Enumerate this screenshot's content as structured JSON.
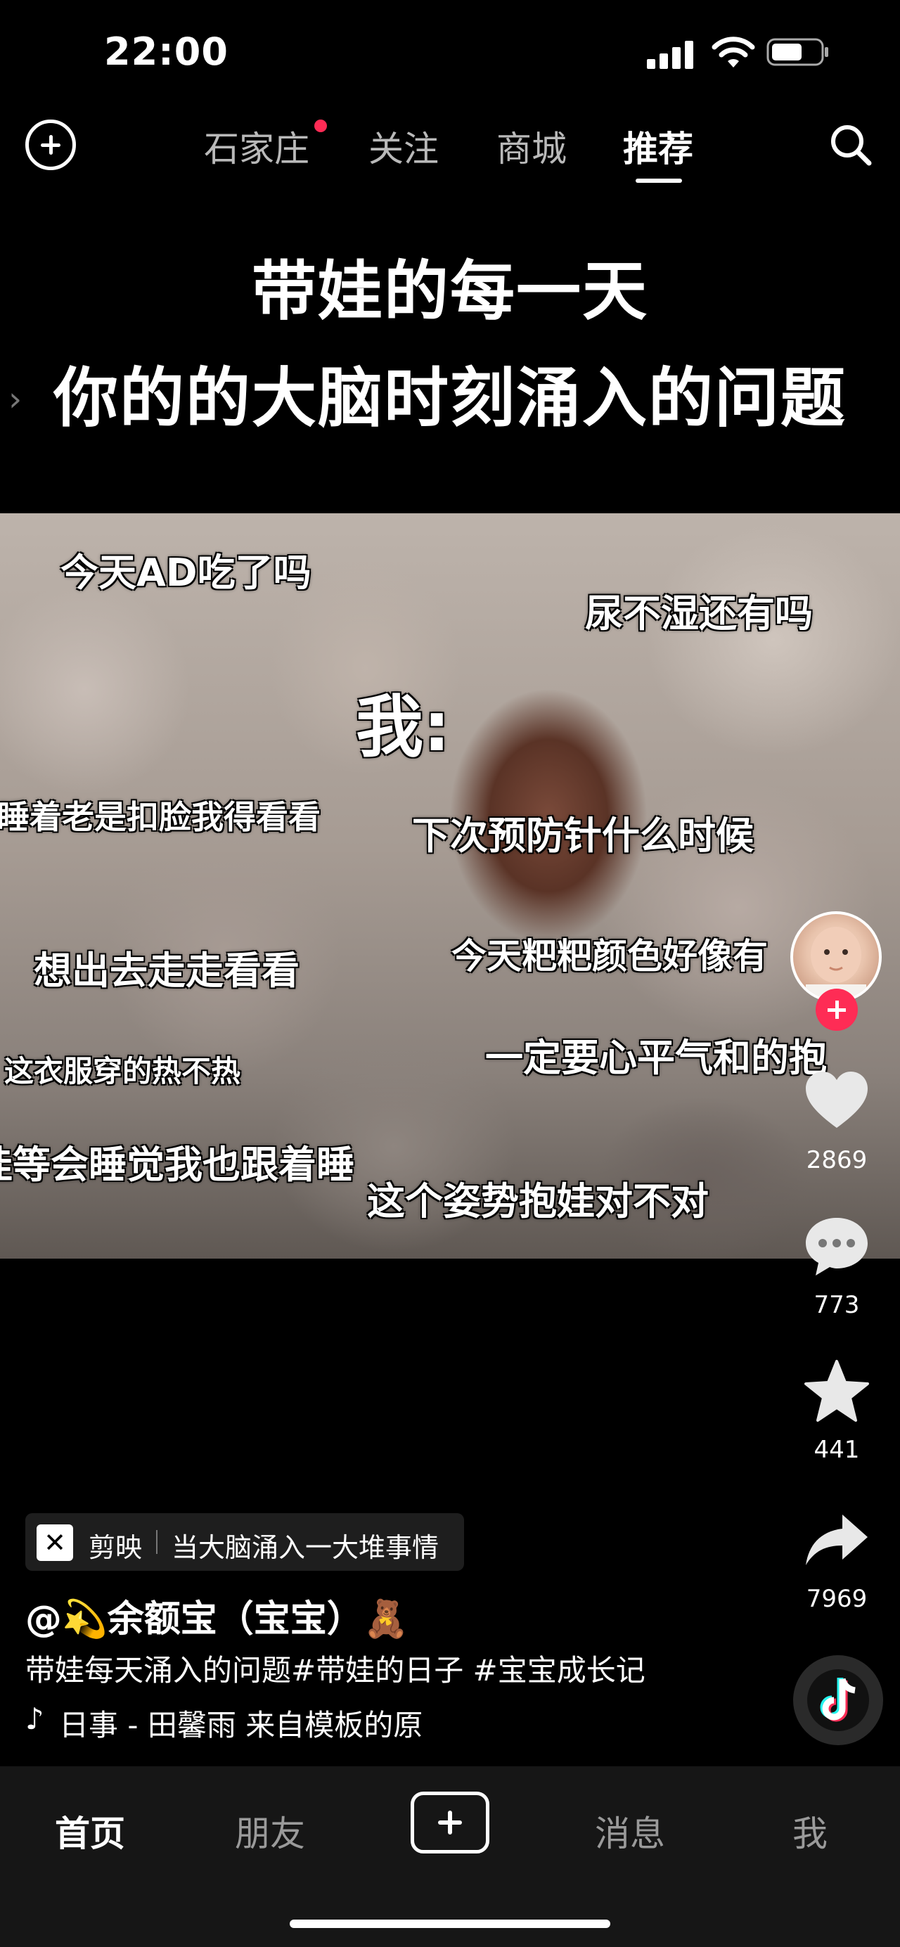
{
  "status_bar": {
    "time": "22:00"
  },
  "top_nav": {
    "tabs": [
      {
        "label": "石家庄",
        "has_dot": true
      },
      {
        "label": "关注"
      },
      {
        "label": "商城"
      },
      {
        "label": "推荐",
        "active": true
      }
    ]
  },
  "video": {
    "headline_line1": "带娃的每一天",
    "headline_line2": "你的的大脑时刻涌入的问题",
    "overlay_texts": [
      "今天AD吃了吗",
      "尿不湿还有吗",
      "我:",
      "睡着老是扣脸我得看看",
      "下次预防针什么时候",
      "今天粑粑颜色好像有",
      "想出去走走看看",
      "一定要心平气和的抱",
      "这衣服穿的热不热",
      "娃等会睡觉我也跟着睡",
      "这个姿势抱娃对不对"
    ]
  },
  "actions": {
    "likes": "2869",
    "comments": "773",
    "favorites": "441",
    "shares": "7969"
  },
  "info": {
    "capcut_name": "剪映",
    "capcut_desc": "当大脑涌入一大堆事情",
    "author": "@💫余额宝（宝宝）🧸",
    "description": "带娃每天涌入的问题#带娃的日子 #宝宝成长记",
    "music": "日事 - 田馨雨    来自模板的原"
  },
  "bottom_nav": {
    "home": "首页",
    "friends": "朋友",
    "messages": "消息",
    "me": "我"
  },
  "colors": {
    "accent": "#fe2c55",
    "background": "#000000",
    "nav_bg": "#161616"
  }
}
